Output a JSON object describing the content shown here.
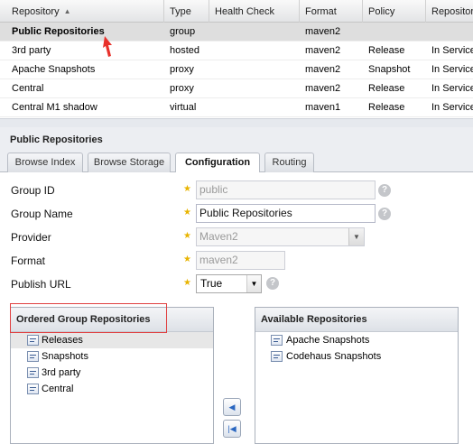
{
  "grid": {
    "columns": [
      "Repository",
      "Type",
      "Health Check",
      "Format",
      "Policy",
      "Repositor"
    ],
    "rows": [
      {
        "repository": "Public Repositories",
        "type": "group",
        "health": "",
        "format": "maven2",
        "policy": "",
        "status": ""
      },
      {
        "repository": "3rd party",
        "type": "hosted",
        "health": "",
        "format": "maven2",
        "policy": "Release",
        "status": "In Service"
      },
      {
        "repository": "Apache Snapshots",
        "type": "proxy",
        "health": "",
        "format": "maven2",
        "policy": "Snapshot",
        "status": "In Service"
      },
      {
        "repository": "Central",
        "type": "proxy",
        "health": "",
        "format": "maven2",
        "policy": "Release",
        "status": "In Service"
      },
      {
        "repository": "Central M1 shadow",
        "type": "virtual",
        "health": "",
        "format": "maven1",
        "policy": "Release",
        "status": "In Service"
      }
    ],
    "selected_row": 0
  },
  "panel": {
    "title": "Public Repositories",
    "tabs": [
      "Browse Index",
      "Browse Storage",
      "Configuration",
      "Routing"
    ],
    "active_tab": "Configuration"
  },
  "form": {
    "group_id": {
      "label": "Group ID",
      "value": "public"
    },
    "group_name": {
      "label": "Group Name",
      "value": "Public Repositories"
    },
    "provider": {
      "label": "Provider",
      "value": "Maven2"
    },
    "format": {
      "label": "Format",
      "value": "maven2"
    },
    "publish_url": {
      "label": "Publish URL",
      "value": "True"
    }
  },
  "ordered_group": {
    "title": "Ordered Group Repositories",
    "items": [
      "Releases",
      "Snapshots",
      "3rd party",
      "Central"
    ],
    "selected_index": 0
  },
  "available": {
    "title": "Available Repositories",
    "items": [
      "Apache Snapshots",
      "Codehaus Snapshots"
    ]
  },
  "icons": {
    "sort": "sort-ascending-icon",
    "required": "required-star-icon",
    "help": "help-icon",
    "dropdown": "chevron-down-icon",
    "repo": "repository-icon",
    "move_left": "arrow-left-icon",
    "move_first": "arrow-first-icon",
    "pointer": "red-arrow-pointer"
  },
  "colors": {
    "selected_row": "#dedede",
    "highlight_border": "#e04040",
    "required_star": "#e8b400",
    "pointer": "#e8302a"
  }
}
